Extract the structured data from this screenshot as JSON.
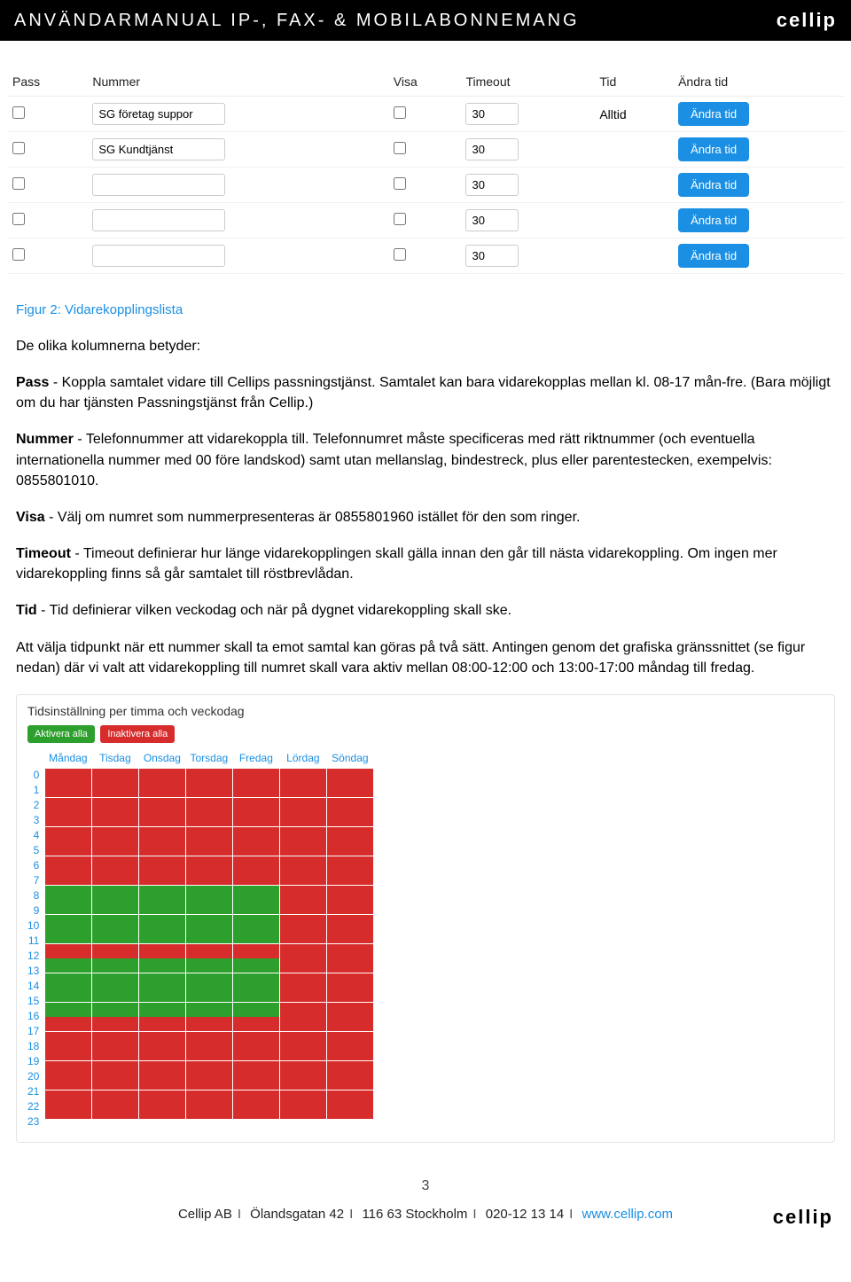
{
  "header": {
    "title": "ANVÄNDARMANUAL IP-, FAX- & MOBILABONNEMANG",
    "brand": "cellip"
  },
  "forwarding": {
    "columns": [
      "Pass",
      "Nummer",
      "Visa",
      "Timeout",
      "Tid",
      "Ändra tid"
    ],
    "button_label": "Ändra tid",
    "rows": [
      {
        "pass": false,
        "nummer": "SG företag suppor",
        "visa": false,
        "timeout": "30",
        "tid": "Alltid"
      },
      {
        "pass": false,
        "nummer": "SG Kundtjänst",
        "visa": false,
        "timeout": "30",
        "tid": ""
      },
      {
        "pass": false,
        "nummer": "",
        "visa": false,
        "timeout": "30",
        "tid": ""
      },
      {
        "pass": false,
        "nummer": "",
        "visa": false,
        "timeout": "30",
        "tid": ""
      },
      {
        "pass": false,
        "nummer": "",
        "visa": false,
        "timeout": "30",
        "tid": ""
      }
    ]
  },
  "text": {
    "fig_caption": "Figur 2: Vidarekopplingslista",
    "intro": "De olika kolumnerna betyder:",
    "pass_label": "Pass",
    "pass_body": " - Koppla samtalet vidare till Cellips passningstjänst. Samtalet kan bara vidarekopplas mellan kl. 08-17 mån-fre. (Bara möjligt om du har tjänsten Passningstjänst från Cellip.)",
    "nummer_label": "Nummer",
    "nummer_body": " - Telefonnummer att vidarekoppla till. Telefonnumret måste specificeras med rätt riktnummer (och eventuella internationella nummer med 00 före landskod) samt utan mellanslag, bindestreck, plus eller parentestecken, exempelvis: 0855801010.",
    "visa_label": "Visa",
    "visa_body": " - Välj om numret som nummerpresenteras är 0855801960 istället för den som ringer.",
    "timeout_label": "Timeout",
    "timeout_body": " - Timeout definierar hur länge vidarekopplingen skall gälla innan den går till nästa vidarekoppling. Om ingen mer vidarekoppling finns så går samtalet till röstbrevlådan.",
    "tid_label": "Tid",
    "tid_body": " - Tid definierar vilken veckodag och när på dygnet vidarekoppling skall ske.",
    "schedule_para": "Att välja tidpunkt när ett nummer skall ta emot samtal kan göras på två sätt. Antingen genom det grafiska gränssnittet (se figur nedan) där vi valt att vidarekoppling till numret skall vara aktiv mellan 08:00-12:00 och 13:00-17:00 måndag till fredag."
  },
  "schedule": {
    "title": "Tidsinställning per timma och veckodag",
    "activate_all": "Aktivera alla",
    "deactivate_all": "Inaktivera alla",
    "days": [
      "Måndag",
      "Tisdag",
      "Onsdag",
      "Torsdag",
      "Fredag",
      "Lördag",
      "Söndag"
    ],
    "hours": [
      "0",
      "1",
      "2",
      "3",
      "4",
      "5",
      "6",
      "7",
      "8",
      "9",
      "10",
      "11",
      "12",
      "13",
      "14",
      "15",
      "16",
      "17",
      "18",
      "19",
      "20",
      "21",
      "22",
      "23"
    ],
    "active_hours_weekday": [
      8,
      9,
      10,
      11,
      13,
      14,
      15,
      16
    ]
  },
  "footer": {
    "page": "3",
    "company": "Cellip AB",
    "address": "Ölandsgatan 42",
    "postal": "116 63 Stockholm",
    "phone": "020-12 13 14",
    "url": "www.cellip.com",
    "brand": "cellip"
  }
}
